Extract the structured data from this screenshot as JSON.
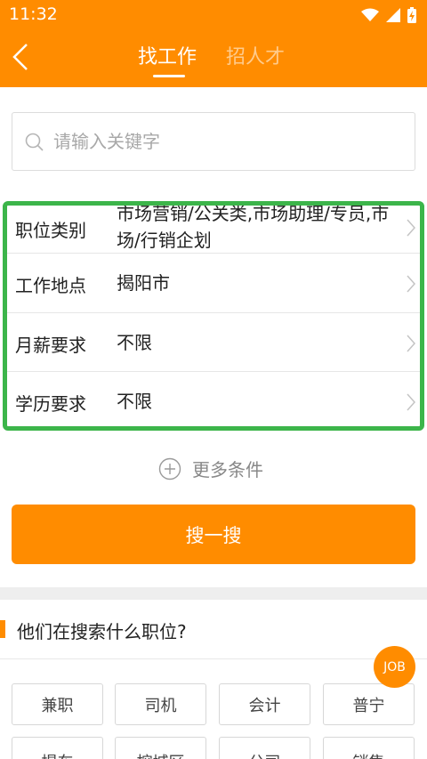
{
  "status": {
    "time": "11:32"
  },
  "header": {
    "tab_find": "找工作",
    "tab_hire": "招人才",
    "accent": "#ff8c00"
  },
  "search": {
    "placeholder": "请输入关键字"
  },
  "filters": [
    {
      "label": "职位类别",
      "value": "市场营销/公关类,市场助理/专员,市场/行销企划"
    },
    {
      "label": "工作地点",
      "value": "揭阳市"
    },
    {
      "label": "月薪要求",
      "value": "不限"
    },
    {
      "label": "学历要求",
      "value": "不限"
    }
  ],
  "more_conditions": "更多条件",
  "search_button": "搜一搜",
  "hot": {
    "title": "他们在搜索什么职位?",
    "tags_row1": [
      "兼职",
      "司机",
      "会计",
      "普宁"
    ],
    "tags_row2": [
      "提车",
      "榕城区",
      "公司",
      "销售"
    ]
  },
  "fab_label": "JOB",
  "highlight_color": "#3cb54a"
}
